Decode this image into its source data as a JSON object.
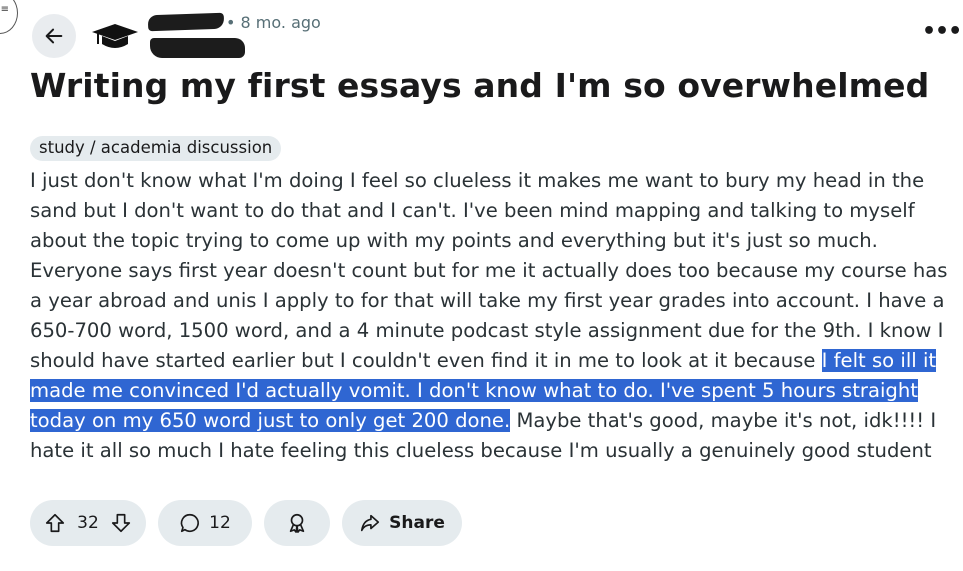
{
  "post": {
    "time_ago": "8 mo. ago",
    "title": "Writing my first essays and I'm so overwhelmed",
    "flair": "study / academia discussion",
    "body_before": "I just don't know what I'm doing I feel so clueless it makes me want to bury my head in the sand but I don't want to do that and I can't. I've been mind mapping and talking to myself about the topic trying to come up with my points and everything but it's just so much. Everyone says first year doesn't count but for me it actually does too because my course has a year abroad and unis I apply to for that will take my first year grades into account. I have a 650-700 word, 1500 word, and a 4 minute podcast style assignment due for the 9th. I know I should have started earlier but I couldn't even find it in me to look at it because ",
    "body_highlighted": "I felt so ill it made me convinced I'd actually vomit. I don't know what to do. I've spent 5 hours straight today on my 650 word just to only get 200 done.",
    "body_after": " Maybe that's good, maybe it's not, idk!!!! I hate it all so much I hate feeling this clueless because I'm usually a genuinely good student"
  },
  "actions": {
    "upvotes": "32",
    "comments": "12",
    "share_label": "Share"
  },
  "icons": {
    "back": "arrow-left-icon",
    "community": "graduation-cap-icon",
    "more": "more-horizontal-icon",
    "upvote": "arrow-up-icon",
    "downvote": "arrow-down-icon",
    "comment": "speech-bubble-icon",
    "award": "award-ribbon-icon",
    "share": "share-arrow-icon",
    "menu": "hamburger-menu-icon"
  },
  "colors": {
    "selection_highlight": "#2f66d2",
    "pill_background": "#e5ebee",
    "meta_text": "#576f76"
  }
}
